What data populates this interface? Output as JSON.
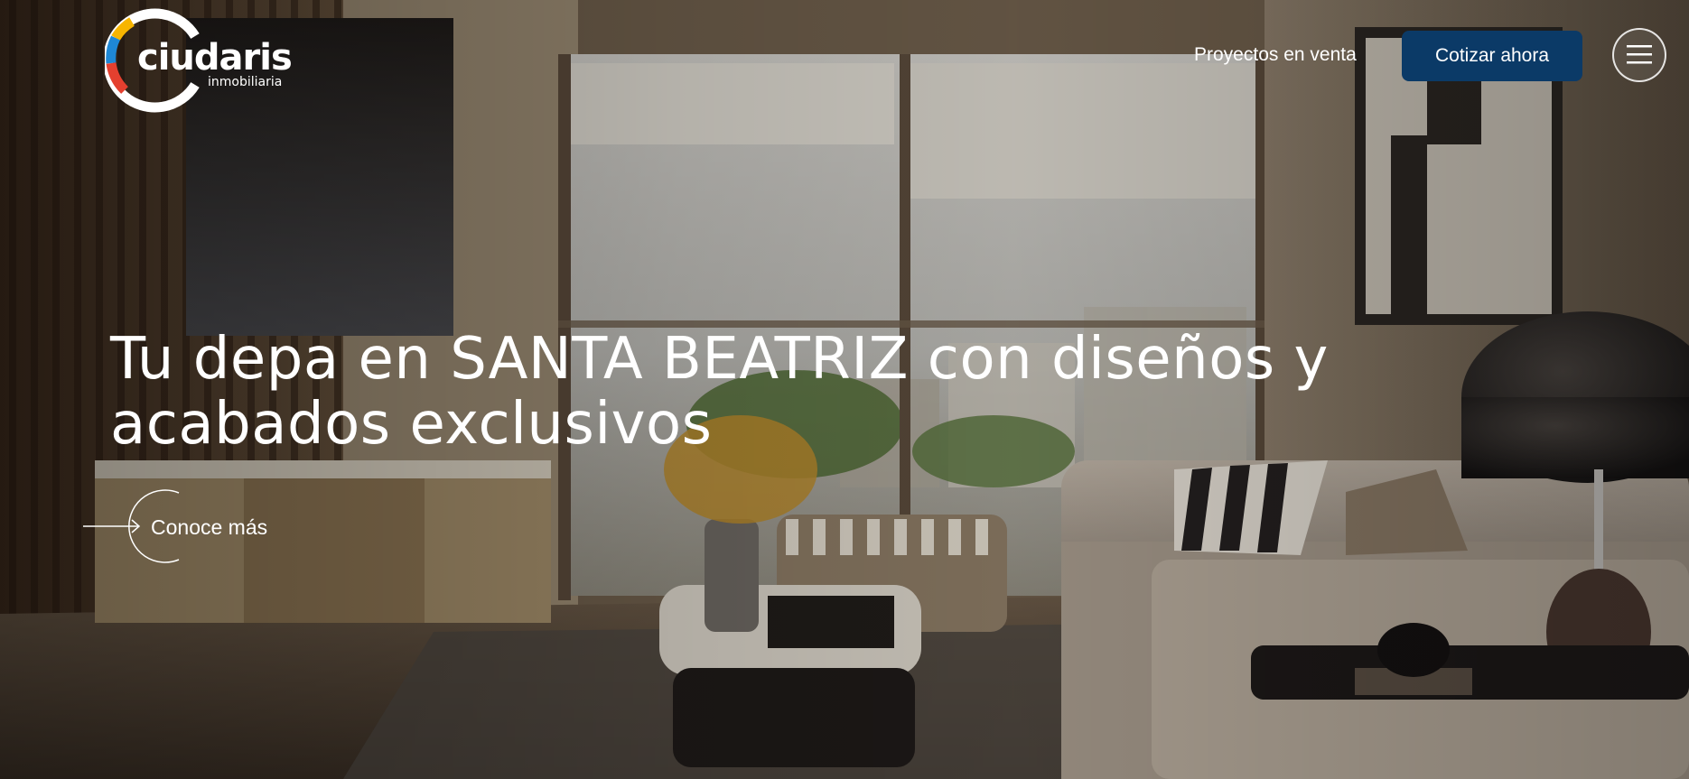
{
  "header": {
    "logo": {
      "brand_name": "ciudaris",
      "tagline": "inmobiliaria"
    },
    "nav_link_label": "Proyectos en venta",
    "cta_label": "Cotizar ahora",
    "menu_icon": "hamburger-icon"
  },
  "hero": {
    "headline": "Tu depa en SANTA BEATRIZ con diseños y acabados exclusivos",
    "learn_more_label": "Conoce más",
    "learn_more_icon": "arrow-right-icon",
    "background": "living-room-photo"
  },
  "colors": {
    "cta_background": "#0b3a67",
    "text": "#ffffff",
    "logo_yellow": "#f7b500",
    "logo_blue": "#1e88d6",
    "logo_red": "#e4402f"
  }
}
